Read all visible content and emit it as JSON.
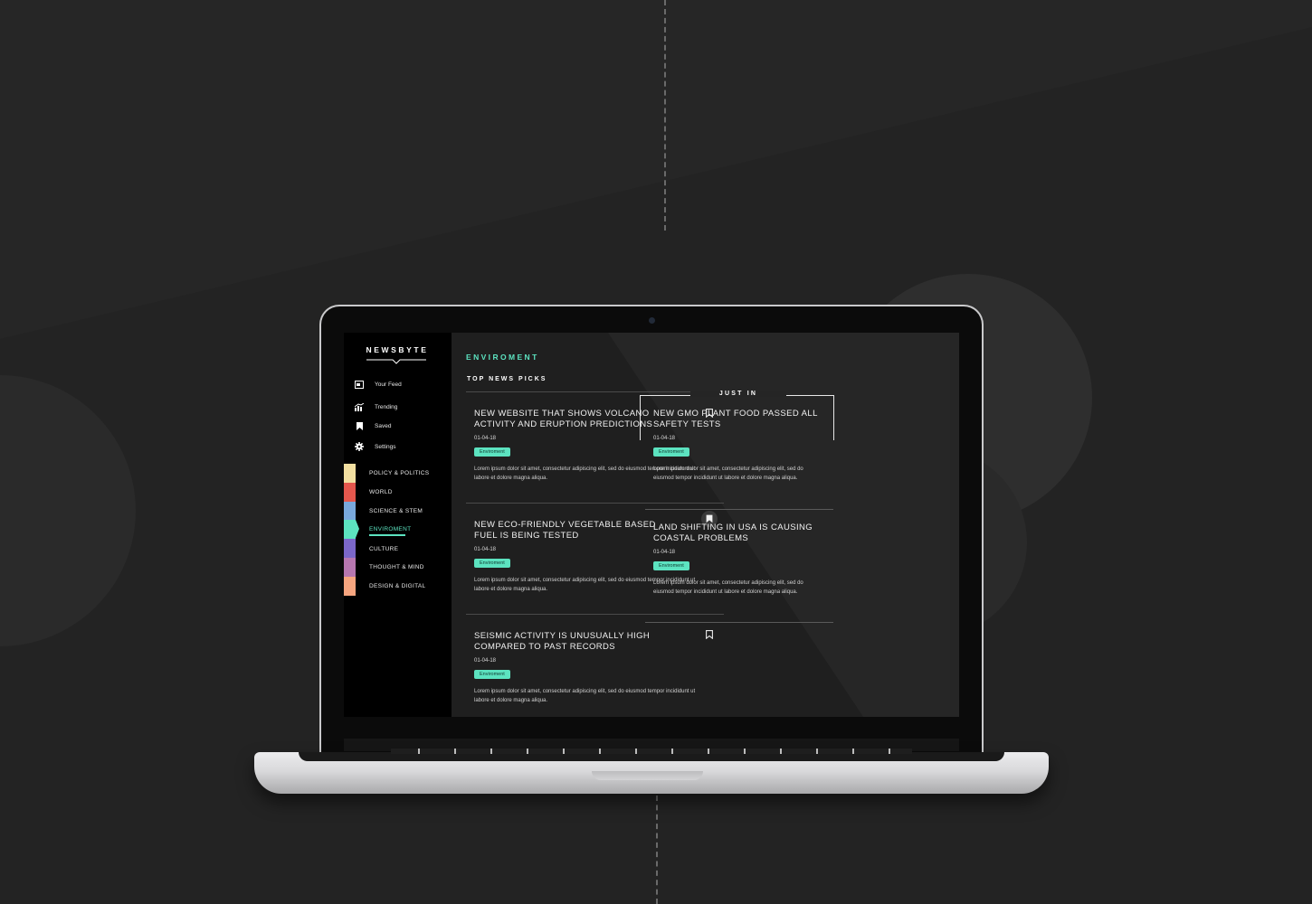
{
  "app": {
    "logo": "NEWSBYTE"
  },
  "sidebar": {
    "nav": [
      {
        "label": "Your Feed",
        "icon": "feed-icon"
      },
      {
        "label": "Trending",
        "icon": "trending-icon"
      },
      {
        "label": "Saved",
        "icon": "bookmark-icon"
      },
      {
        "label": "Settings",
        "icon": "gear-icon"
      }
    ],
    "categories": [
      {
        "label": "POLICY & POLITICS",
        "color": "#f2dfa0"
      },
      {
        "label": "WORLD",
        "color": "#e4574d"
      },
      {
        "label": "SCIENCE & STEM",
        "color": "#79a9dd"
      },
      {
        "label": "ENVIROMENT",
        "color": "#5ce3c0",
        "active": true
      },
      {
        "label": "CULTURE",
        "color": "#7b67c9"
      },
      {
        "label": "THOUGHT & MIND",
        "color": "#b777b0"
      },
      {
        "label": "DESIGN & DIGITAL",
        "color": "#f6a57f"
      }
    ]
  },
  "main": {
    "section_title": "ENVIROMENT",
    "sub_title": "TOP NEWS PICKS",
    "articles": [
      {
        "title": "NEW WEBSITE THAT SHOWS VOLCANO ACTIVITY AND ERUPTION PREDICTIONS",
        "date": "01-04-18",
        "tag": "Enviroment",
        "body": "Lorem ipsum dolor sit amet, consectetur adipiscing elit, sed do eiusmod tempor incididunt ut labore et dolore magna aliqua.",
        "saved": false
      },
      {
        "title": "NEW ECO-FRIENDLY VEGETABLE BASED FUEL IS BEING TESTED",
        "date": "01-04-18",
        "tag": "Enviroment",
        "body": "Lorem ipsum dolor sit amet, consectetur adipiscing elit, sed do eiusmod tempor incididunt ut labore et dolore magna aliqua.",
        "saved": true
      },
      {
        "title": "SEISMIC ACTIVITY IS UNUSUALLY HIGH COMPARED TO PAST RECORDS",
        "date": "01-04-18",
        "tag": "Enviroment",
        "body": "Lorem ipsum dolor sit amet, consectetur adipiscing elit, sed do eiusmod tempor incididunt ut labore et dolore magna aliqua.",
        "saved": false
      }
    ]
  },
  "just_in": {
    "label": "JUST IN",
    "articles": [
      {
        "title": "NEW GMO PLANT FOOD PASSED ALL SAFETY TESTS",
        "date": "01-04-18",
        "tag": "Enviroment",
        "body": "Lorem ipsum dolor sit amet, consectetur adipiscing elit, sed do eiusmod tempor incididunt ut labore et dolore magna aliqua."
      },
      {
        "title": "LAND SHIFTING IN USA IS CAUSING COASTAL PROBLEMS",
        "date": "01-04-18",
        "tag": "Enviroment",
        "body": "Lorem ipsum dolor sit amet, consectetur adipiscing elit, sed do eiusmod tempor incididunt ut labore et dolore magna aliqua."
      }
    ]
  },
  "colors": {
    "accent": "#5ce3c0",
    "background": "#232323",
    "sidebar": "#000000"
  }
}
